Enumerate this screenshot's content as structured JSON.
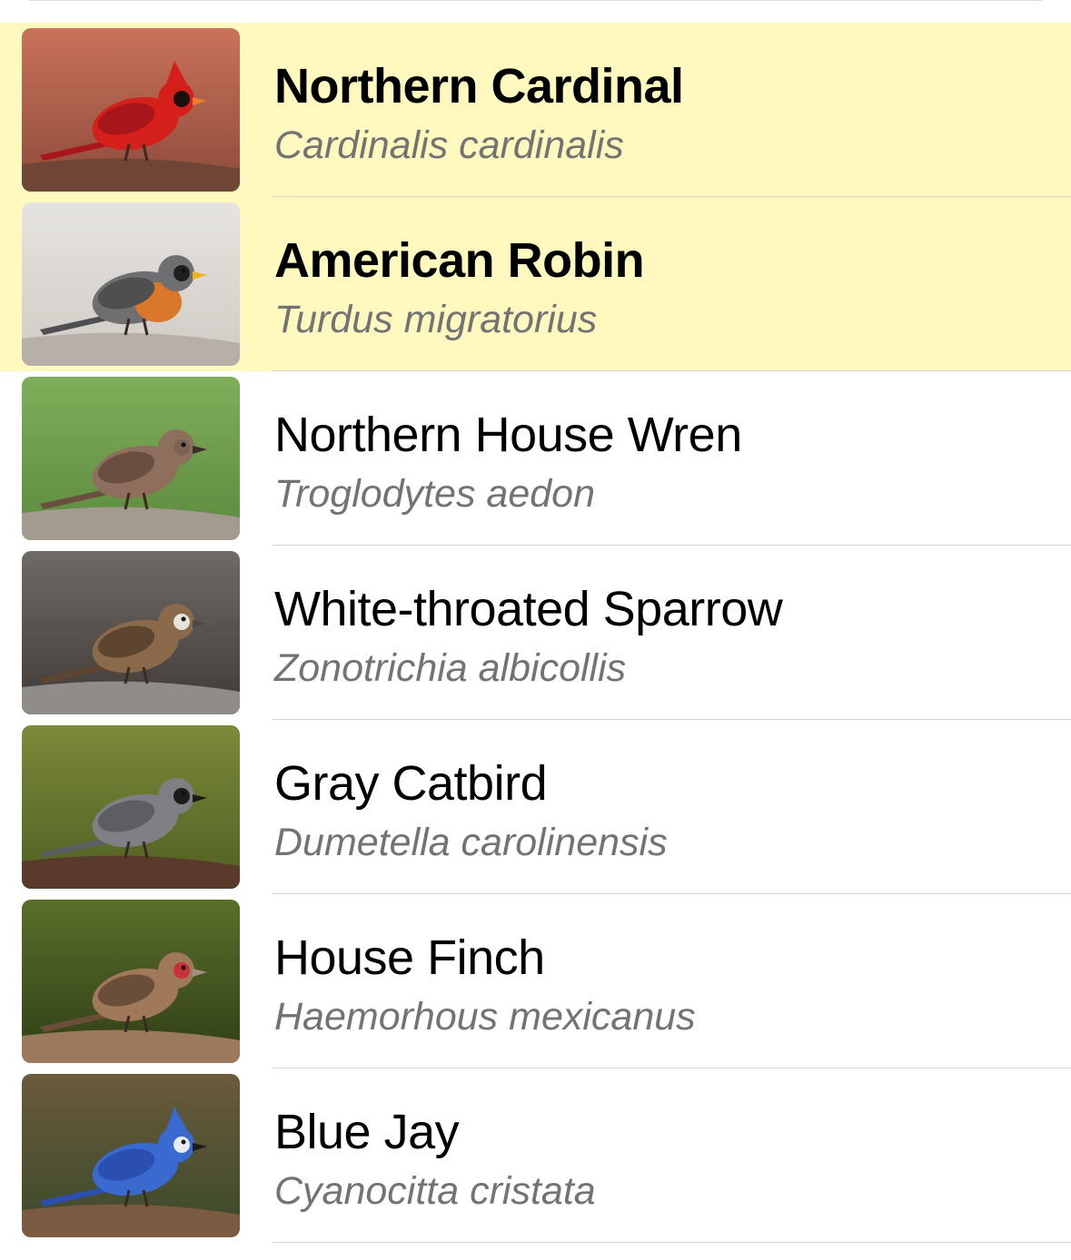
{
  "birds": [
    {
      "common": "Northern Cardinal",
      "scientific": "Cardinalis cardinalis",
      "highlighted": true,
      "photo": {
        "bg1": "#c9725a",
        "bg2": "#8c4a3a",
        "ground": "#6e4536",
        "body": "#d41f1a",
        "wing": "#a8151a",
        "mask": "#1a1010",
        "beak": "#f07a2a",
        "crest": true
      }
    },
    {
      "common": "American Robin",
      "scientific": "Turdus migratorius",
      "highlighted": true,
      "photo": {
        "bg1": "#e6e4e0",
        "bg2": "#cfcac4",
        "ground": "#b7b0a8",
        "body": "#6f6f72",
        "wing": "#4f4f52",
        "mask": "#1f1f22",
        "beak": "#f0b020",
        "breast": "#d9782a",
        "crest": false
      }
    },
    {
      "common": "Northern House Wren",
      "scientific": "Troglodytes aedon",
      "highlighted": false,
      "photo": {
        "bg1": "#7fae5a",
        "bg2": "#5c8a3e",
        "ground": "#a49a90",
        "body": "#8e6f5e",
        "wing": "#6a4f40",
        "mask": "#7d6253",
        "beak": "#3a2e28",
        "crest": false
      }
    },
    {
      "common": "White-throated Sparrow",
      "scientific": "Zonotrichia albicollis",
      "highlighted": false,
      "photo": {
        "bg1": "#6f6a66",
        "bg2": "#3f3a36",
        "ground": "#8f8c8a",
        "body": "#8a6a4a",
        "wing": "#5e4530",
        "mask": "#e8e2d8",
        "beak": "#4a4a4a",
        "crest": false
      }
    },
    {
      "common": "Gray Catbird",
      "scientific": "Dumetella carolinensis",
      "highlighted": false,
      "photo": {
        "bg1": "#7c8a3a",
        "bg2": "#4f5f22",
        "ground": "#5a3a2a",
        "body": "#7e8084",
        "wing": "#5c5e62",
        "mask": "#1c1c1e",
        "beak": "#1c1c1e",
        "crest": false
      }
    },
    {
      "common": "House Finch",
      "scientific": "Haemorhous mexicanus",
      "highlighted": false,
      "photo": {
        "bg1": "#5a6e2a",
        "bg2": "#2f3e16",
        "ground": "#9a7a5a",
        "body": "#a0785a",
        "wing": "#6a4e3a",
        "mask": "#c8303a",
        "beak": "#a09080",
        "crest": false
      }
    },
    {
      "common": "Blue Jay",
      "scientific": "Cyanocitta cristata",
      "highlighted": false,
      "photo": {
        "bg1": "#6a5a3a",
        "bg2": "#3a4a2a",
        "ground": "#7a5a40",
        "body": "#3a6ad0",
        "wing": "#2a4fb0",
        "mask": "#e8ecf2",
        "beak": "#1a1a1a",
        "crest": true
      }
    }
  ]
}
